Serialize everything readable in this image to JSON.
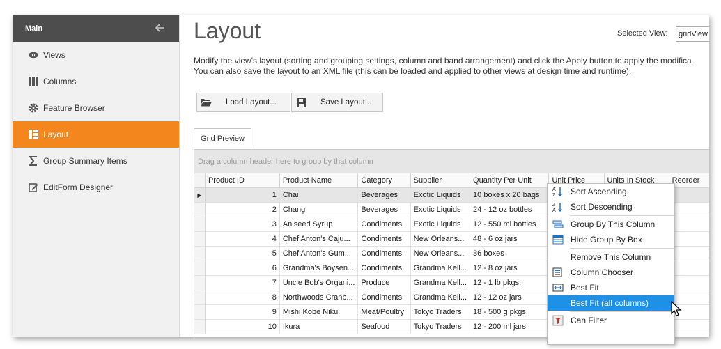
{
  "sidebar": {
    "header": "Main",
    "items": [
      {
        "label": "Views",
        "icon": "eye-icon"
      },
      {
        "label": "Columns",
        "icon": "columns-icon"
      },
      {
        "label": "Feature Browser",
        "icon": "gear-icon"
      },
      {
        "label": "Layout",
        "icon": "layout-icon"
      },
      {
        "label": "Group Summary Items",
        "icon": "sigma-icon"
      },
      {
        "label": "EditForm Designer",
        "icon": "edit-form-icon"
      }
    ],
    "active_index": 3
  },
  "main": {
    "title": "Layout",
    "selected_view_label": "Selected View:",
    "selected_view_value": "gridView",
    "desc_line1": "Modify the view's layout (sorting and grouping settings, column and band arrangement) and click the Apply button to apply the modifica",
    "desc_line2": "You can also save the layout to an XML file (this can be loaded and applied to other views at design time and runtime).",
    "load_button": "Load Layout...",
    "save_button": "Save Layout...",
    "tab": "Grid Preview"
  },
  "grid": {
    "group_panel_text": "Drag a column header here to group by that column",
    "columns": [
      "Product ID",
      "Product Name",
      "Category",
      "Supplier",
      "Quantity Per Unit",
      "Unit Price",
      "Units In Stock",
      "Reorder"
    ],
    "rows": [
      [
        "1",
        "Chai",
        "Beverages",
        "Exotic Liquids",
        "10 boxes x 20 bags"
      ],
      [
        "2",
        "Chang",
        "Beverages",
        "Exotic Liquids",
        "24 - 12 oz bottles"
      ],
      [
        "3",
        "Aniseed Syrup",
        "Condiments",
        "Exotic Liquids",
        "12 - 550 ml bottles"
      ],
      [
        "4",
        "Chef Anton's Caju...",
        "Condiments",
        "New Orleans...",
        "48 - 6 oz jars"
      ],
      [
        "5",
        "Chef Anton's Gum...",
        "Condiments",
        "New Orleans...",
        "36 boxes"
      ],
      [
        "6",
        "Grandma's Boysen...",
        "Condiments",
        "Grandma Kell...",
        "12 - 8 oz jars"
      ],
      [
        "7",
        "Uncle Bob's Organi...",
        "Produce",
        "Grandma Kell...",
        "12 - 1 lb pkgs."
      ],
      [
        "8",
        "Northwoods Cranb...",
        "Condiments",
        "Grandma Kell...",
        "12 - 12 oz jars"
      ],
      [
        "9",
        "Mishi Kobe Niku",
        "Meat/Poultry",
        "Tokyo Traders",
        "18 - 500 g pkgs."
      ],
      [
        "10",
        "Ikura",
        "Seafood",
        "Tokyo Traders",
        "12 - 200 ml jars"
      ]
    ]
  },
  "context_menu": {
    "items": [
      {
        "label": "Sort Ascending",
        "icon": "sort-ascending-icon"
      },
      {
        "label": "Sort Descending",
        "icon": "sort-descending-icon"
      },
      {
        "label": "Group By This Column",
        "icon": "group-by-column-icon"
      },
      {
        "label": "Hide Group By Box",
        "icon": "group-by-box-icon"
      },
      {
        "label": "Remove This Column",
        "icon": ""
      },
      {
        "label": "Column Chooser",
        "icon": "column-chooser-icon"
      },
      {
        "label": "Best Fit",
        "icon": "best-fit-icon"
      },
      {
        "label": "Best Fit (all columns)",
        "icon": ""
      },
      {
        "label": "Can Filter",
        "icon": "filter-icon"
      }
    ],
    "highlighted": "Best Fit (all columns)"
  },
  "colors": {
    "accent": "#f3871e",
    "sidebar_header": "#4d4d4d",
    "menu_highlight": "#1e90e6"
  }
}
